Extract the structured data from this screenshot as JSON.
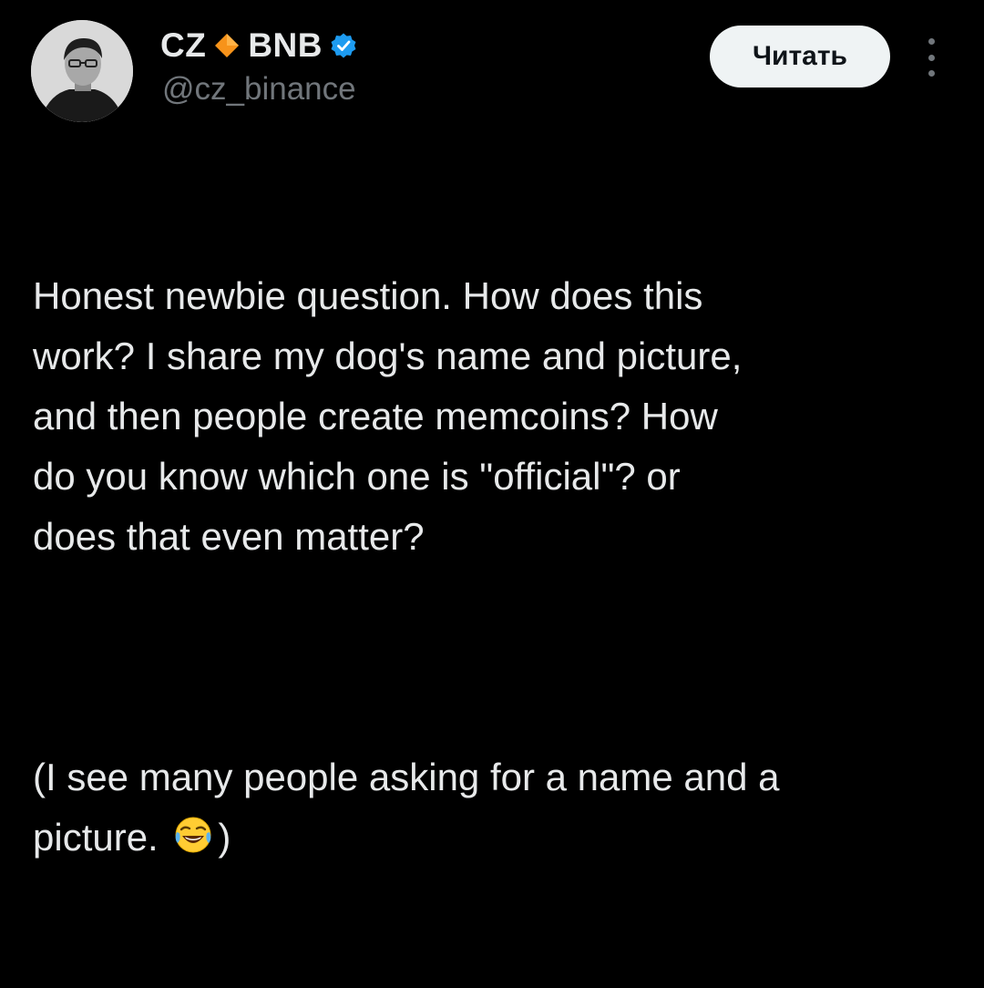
{
  "author": {
    "display_name_prefix": "CZ",
    "display_name_suffix": "BNB",
    "handle": "@cz_binance",
    "diamond_icon": "orange-diamond-icon",
    "verified_icon": "verified-badge-icon",
    "diamond_color": "#f7931a",
    "verified_color": "#1d9bf0"
  },
  "actions": {
    "follow_label": "Читать",
    "more_icon": "more-vertical-icon"
  },
  "tweet": {
    "paragraph1": "Honest newbie question. How does this\nwork? I share my dog's name and picture,\nand then people create memcoins? How\ndo you know which one is \"official\"? or\ndoes that even matter?",
    "paragraph2_line1": "(I see many people asking for a name and a",
    "paragraph2_line2_start": "picture. ",
    "paragraph2_emoji": "tears-of-joy-emoji-icon",
    "paragraph2_line2_end": ")"
  },
  "colors": {
    "background": "#000000",
    "text": "#e7e9ea",
    "secondary_text": "#71767b",
    "button_bg": "#eff3f4"
  }
}
